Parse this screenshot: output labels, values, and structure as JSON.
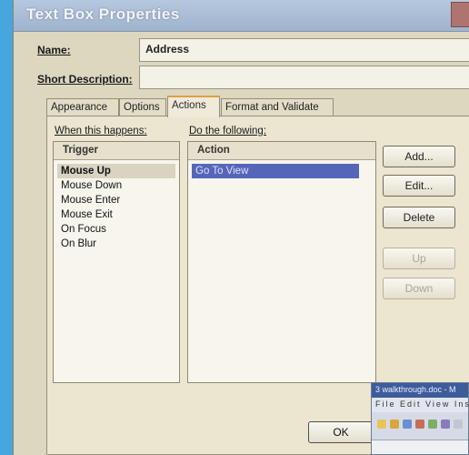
{
  "window": {
    "title": "Text Box Properties"
  },
  "fields": {
    "name_label": "Name:",
    "name_value": "Address",
    "short_desc_label": "Short Description:",
    "short_desc_value": ""
  },
  "tabs": [
    {
      "label": "Appearance",
      "active": false
    },
    {
      "label": "Options",
      "active": false
    },
    {
      "label": "Actions",
      "active": true
    },
    {
      "label": "Format and Validate",
      "active": false
    }
  ],
  "actions": {
    "when_label": "When this happens:",
    "do_label": "Do the following:",
    "trigger_header": "Trigger",
    "triggers": [
      "Mouse Up",
      "Mouse Down",
      "Mouse Enter",
      "Mouse Exit",
      "On Focus",
      "On Blur"
    ],
    "action_header": "Action",
    "actions_list": [
      "Go To View"
    ]
  },
  "buttons": {
    "add": "Add...",
    "edit": "Edit...",
    "delete": "Delete",
    "up": "Up",
    "down": "Down",
    "ok": "OK"
  },
  "thumbnail": {
    "title": "3 walkthrough.doc - M",
    "menu": "File Edit View Insert"
  },
  "colors": {
    "titlebar": "#a9bdd6",
    "dialog_bg": "#ddd7c0",
    "selection_blue": "#5566b8",
    "desktop": "#4da9d9"
  }
}
